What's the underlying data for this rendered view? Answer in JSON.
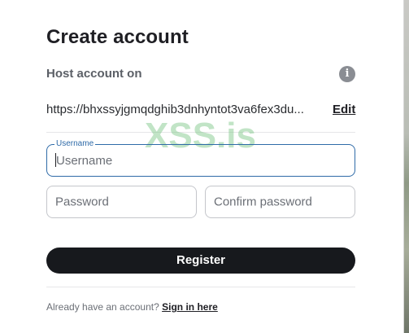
{
  "dialog": {
    "title": "Create account",
    "host_label": "Host account on",
    "info_icon": "info-icon",
    "host_url": "https://bhxssyjgmqdghib3dnhyntot3va6fex3du...",
    "edit_label": "Edit"
  },
  "watermark": "XSS.is",
  "form": {
    "username": {
      "float_label": "Username",
      "placeholder": "Username",
      "value": ""
    },
    "password": {
      "placeholder": "Password",
      "value": ""
    },
    "confirm_password": {
      "placeholder": "Confirm password",
      "value": ""
    },
    "register_label": "Register"
  },
  "footer": {
    "prompt": "Already have an account?",
    "signin_label": "Sign in here"
  },
  "colors": {
    "accent": "#2f6ba8",
    "button_bg": "#17191d",
    "watermark": "#76c480"
  }
}
